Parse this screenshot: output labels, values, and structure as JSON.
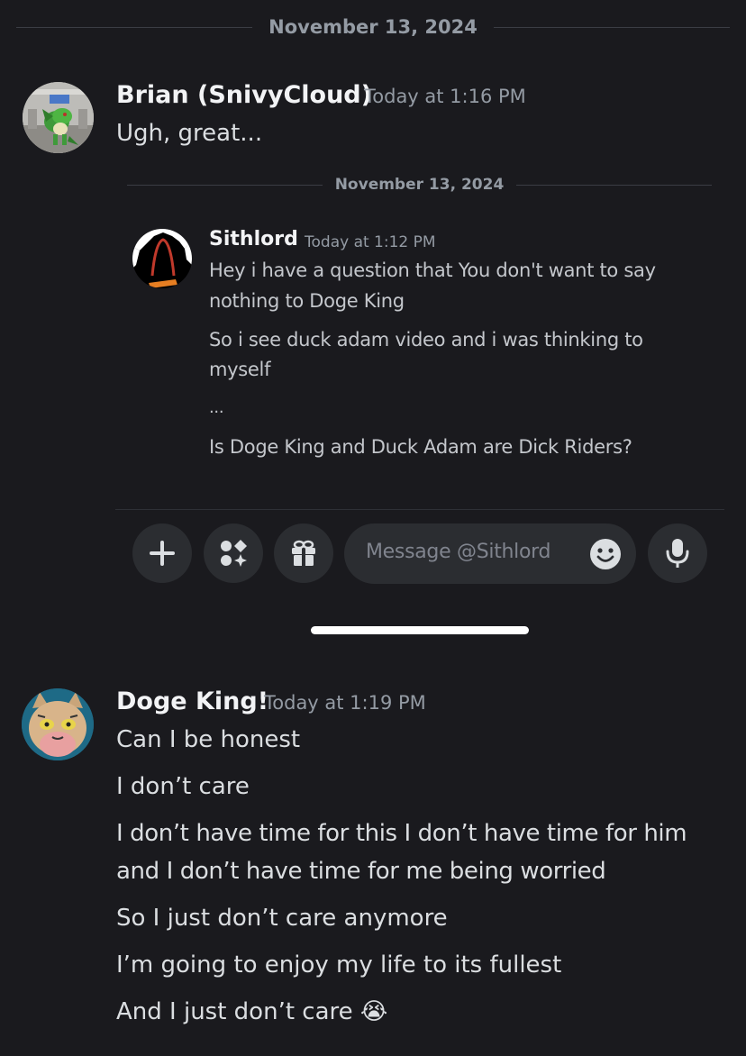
{
  "top_divider": {
    "date": "November 13, 2024"
  },
  "messages": [
    {
      "username": "Brian (SnivyCloud)",
      "timestamp": "Today at 1:16 PM",
      "lines": [
        "Ugh, great..."
      ]
    },
    {
      "username": "Doge King!",
      "timestamp": "Today at 1:19 PM",
      "lines": [
        "Can I be honest",
        "I don’t care",
        "I don’t have time for this I don’t have time for him",
        "and I don’t have time for me being worried",
        "So I just don’t care anymore",
        "I’m going to enjoy my life to its fullest",
        "And I just don’t care 😭"
      ]
    }
  ],
  "screenshot": {
    "divider_date": "November 13, 2024",
    "message": {
      "username": "Sithlord",
      "timestamp": "Today at 1:12 PM",
      "lines": [
        "Hey i have a question that You don't want to say",
        "nothing to Doge King",
        "So i see duck adam video and i was thinking to",
        "myself",
        "...",
        "Is Doge King and Duck Adam are Dick Riders?"
      ]
    },
    "composer": {
      "placeholder": "Message @Sithlord",
      "buttons": [
        "plus-icon",
        "apps-icon",
        "gift-icon",
        "emoji-icon",
        "microphone-icon"
      ]
    }
  },
  "colors": {
    "background": "#1a1a1e",
    "username": "#f2f3f5",
    "timestamp": "#949ba4",
    "message_text": "#dbdee1",
    "input_bg": "#2b2d31"
  }
}
